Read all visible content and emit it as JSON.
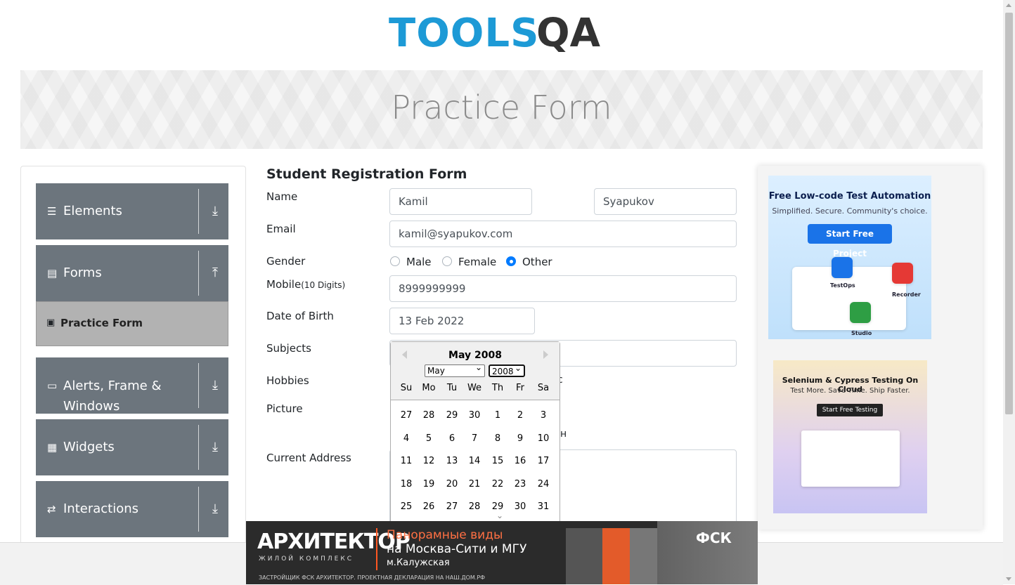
{
  "logo": {
    "left_text": "TOOLS",
    "right_text": "QA"
  },
  "header": {
    "title": "Practice Form"
  },
  "sidebar": {
    "groups": [
      {
        "label": "Elements",
        "icon": "hamburger-icon",
        "arrow": "download-arrow-icon"
      },
      {
        "label": "Forms",
        "icon": "document-icon",
        "arrow": "upload-arrow-icon"
      },
      {
        "label": "Alerts, Frame & Windows",
        "icon": "window-icon",
        "arrow": "download-arrow-icon"
      },
      {
        "label": "Widgets",
        "icon": "grid-icon",
        "arrow": "download-arrow-icon"
      },
      {
        "label": "Interactions",
        "icon": "swap-icon",
        "arrow": "download-arrow-icon"
      }
    ],
    "active_item": {
      "label": "Practice Form",
      "icon": "html-icon"
    }
  },
  "form": {
    "title": "Student Registration Form",
    "labels": {
      "name": "Name",
      "email": "Email",
      "gender": "Gender",
      "mobile": "Mobile",
      "mobile_hint": "(10 Digits)",
      "dob": "Date of Birth",
      "subjects": "Subjects",
      "hobbies": "Hobbies",
      "picture": "Picture",
      "address": "Current Address"
    },
    "first_name": "Kamil",
    "last_name": "Syapukov",
    "email": "kamil@syapukov.com",
    "gender_options": [
      "Male",
      "Female",
      "Other"
    ],
    "gender_selected": "Other",
    "mobile": "8999999999",
    "dob": "13 Feb 2022",
    "partial_hobby_text": "c",
    "partial_picture_text": "н"
  },
  "calendar": {
    "title": "May 2008",
    "month_select": "May",
    "year_select": "2008",
    "day_names": [
      "Su",
      "Mo",
      "Tu",
      "We",
      "Th",
      "Fr",
      "Sa"
    ],
    "weeks": [
      [
        "27",
        "28",
        "29",
        "30",
        "1",
        "2",
        "3"
      ],
      [
        "4",
        "5",
        "6",
        "7",
        "8",
        "9",
        "10"
      ],
      [
        "11",
        "12",
        "13",
        "14",
        "15",
        "16",
        "17"
      ],
      [
        "18",
        "19",
        "20",
        "21",
        "22",
        "23",
        "24"
      ],
      [
        "25",
        "26",
        "27",
        "28",
        "29",
        "30",
        "31"
      ]
    ]
  },
  "ads": {
    "ad1": {
      "title": "Free Low-code Test Automation",
      "subtitle": "Simplified. Secure. Community's choice.",
      "button": "Start Free Project",
      "labels": [
        "TestOps",
        "Recorder",
        "Studio"
      ]
    },
    "ad2": {
      "title": "Selenium & Cypress Testing On Cloud",
      "subtitle": "Test More. Save Time. Ship Faster.",
      "button": "Start Free Testing"
    },
    "bottom": {
      "brand": "АРХИТЕКТОР",
      "brand_sub": "ЖИЛОЙ КОМПЛЕКС",
      "line1": "Панорамные виды",
      "line2": "на Москва-Сити и МГУ",
      "line3": "м.Калужская",
      "disclaimer": "ЗАСТРОЙЩИК ФСК АРХИТЕКТОР. ПРОЕКТНАЯ ДЕКЛАРАЦИЯ НА НАШ.ДОМ.РФ",
      "logo": "ФСК"
    }
  }
}
